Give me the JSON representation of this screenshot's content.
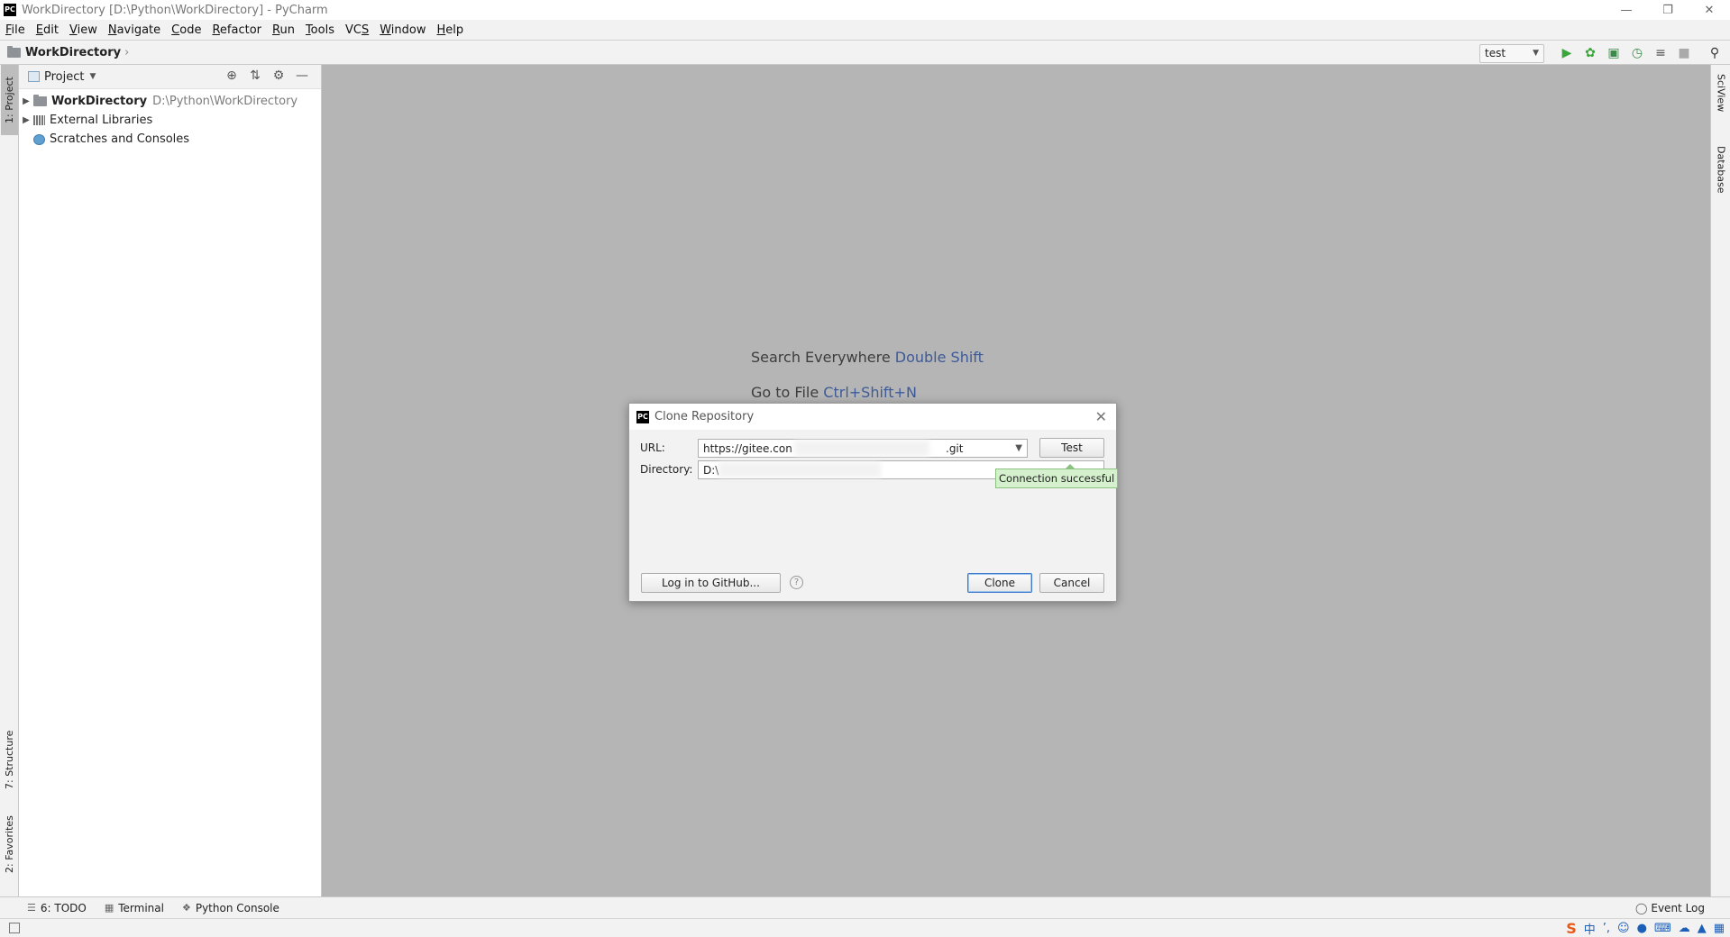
{
  "window": {
    "title": "WorkDirectory [D:\\Python\\WorkDirectory] - PyCharm",
    "logo_text": "PC"
  },
  "menu": {
    "items": [
      {
        "label": "File",
        "mnemonic": "F",
        "rest": "ile"
      },
      {
        "label": "Edit",
        "mnemonic": "E",
        "rest": "dit"
      },
      {
        "label": "View",
        "mnemonic": "V",
        "rest": "iew"
      },
      {
        "label": "Navigate",
        "mnemonic": "N",
        "rest": "avigate"
      },
      {
        "label": "Code",
        "mnemonic": "C",
        "rest": "ode"
      },
      {
        "label": "Refactor",
        "mnemonic": "R",
        "rest": "efactor"
      },
      {
        "label": "Run",
        "mnemonic": "R",
        "rest": "un"
      },
      {
        "label": "Tools",
        "mnemonic": "T",
        "rest": "ools"
      },
      {
        "label": "VCS",
        "mnemonic": "S",
        "pre": "VC"
      },
      {
        "label": "Window",
        "mnemonic": "W",
        "rest": "indow"
      },
      {
        "label": "Help",
        "mnemonic": "H",
        "rest": "elp"
      }
    ]
  },
  "navbar": {
    "breadcrumb": "WorkDirectory",
    "run_config": "test"
  },
  "left_stripe": {
    "project_tab": "1: Project",
    "structure_tab": "7: Structure",
    "favorites_tab": "2: Favorites"
  },
  "project_panel": {
    "title": "Project",
    "tree": [
      {
        "label": "WorkDirectory",
        "path": "D:\\Python\\WorkDirectory"
      },
      {
        "label": "External Libraries"
      },
      {
        "label": "Scratches and Consoles"
      }
    ]
  },
  "editor": {
    "hints": [
      {
        "text": "Search Everywhere",
        "shortcut": "Double Shift"
      },
      {
        "text": "Go to File",
        "shortcut": "Ctrl+Shift+N"
      }
    ]
  },
  "right_stripe": {
    "sciview_tab": "SciView",
    "database_tab": "Database"
  },
  "bottom_tools": {
    "todo": "6: TODO",
    "terminal": "Terminal",
    "python_console": "Python Console",
    "event_log": "Event Log"
  },
  "dialog": {
    "title": "Clone Repository",
    "url_label": "URL:",
    "url_value_start": "https://gitee.con",
    "url_value_end": ".git",
    "directory_label": "Directory:",
    "directory_value": "D:\\",
    "test_button": "Test",
    "connection_status": "Connection successful",
    "login_button": "Log in to GitHub...",
    "clone_button": "Clone",
    "cancel_button": "Cancel",
    "help_icon_text": "?"
  },
  "tray": {
    "ime_logo": "S",
    "ime_mode": "中"
  }
}
